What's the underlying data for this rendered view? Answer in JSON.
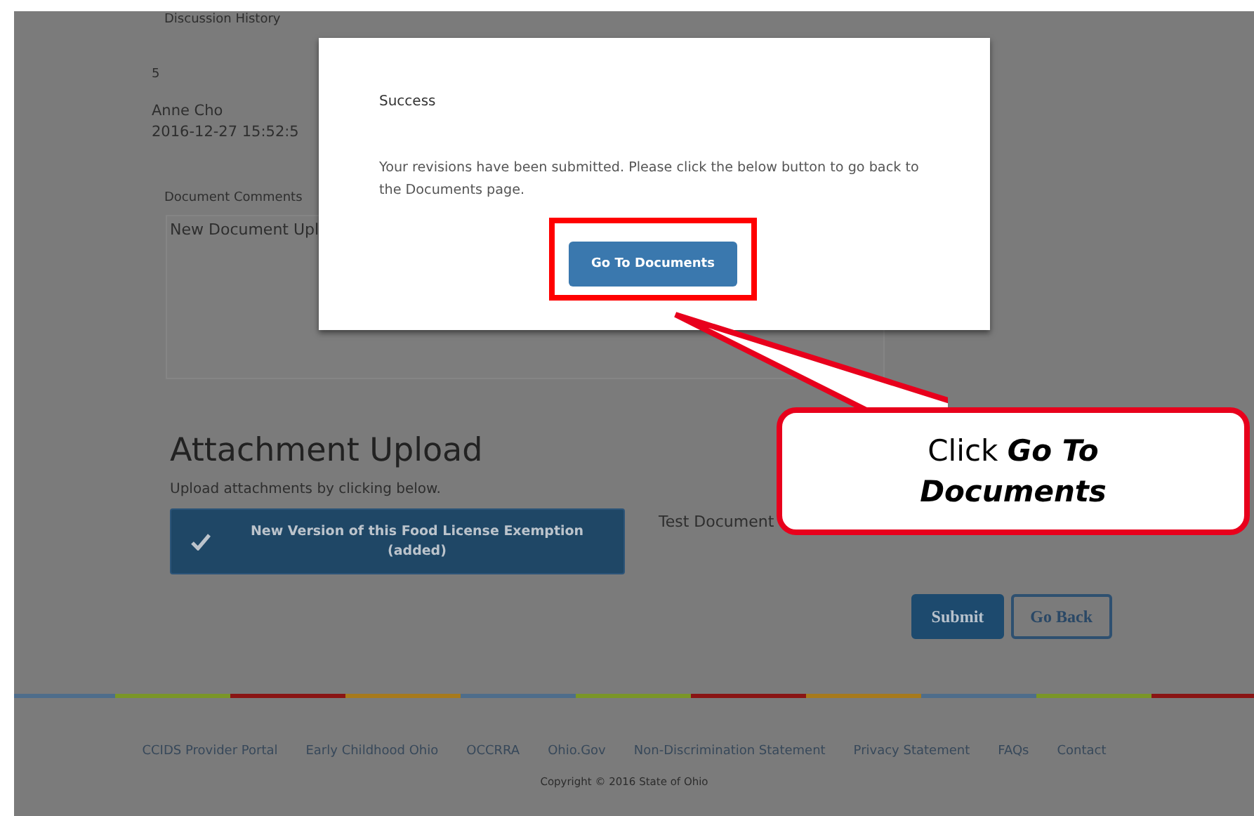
{
  "page": {
    "discussion_history_label": "Discussion History",
    "comment_count": "5",
    "author": "Anne Cho",
    "timestamp": "2016-12-27 15:52:5",
    "comments_label": "Document Comments",
    "comments_value": "New Document Upl"
  },
  "attachments": {
    "title": "Attachment Upload",
    "hint": "Upload attachments by clicking below.",
    "items": [
      {
        "label": "New Version of this Food License Exemption (added)",
        "checked": true
      }
    ],
    "document_name": "Test Document"
  },
  "actions": [
    {
      "label": "Submit",
      "kind": "primary"
    },
    {
      "label": "Go Back",
      "kind": "secondary"
    }
  ],
  "footer": {
    "links": [
      "CCIDS Provider Portal",
      "Early Childhood Ohio",
      "OCCRRA",
      "Ohio.Gov",
      "Non-Discrimination Statement",
      "Privacy Statement",
      "FAQs",
      "Contact"
    ],
    "copyright": "Copyright © 2016 State of Ohio"
  },
  "dialog": {
    "title": "Success",
    "message": "Your revisions have been submitted. Please click the below button to go back to the Documents page.",
    "button": "Go To Documents"
  },
  "callout": {
    "prefix": "Click",
    "emphasis": "Go To Documents"
  }
}
